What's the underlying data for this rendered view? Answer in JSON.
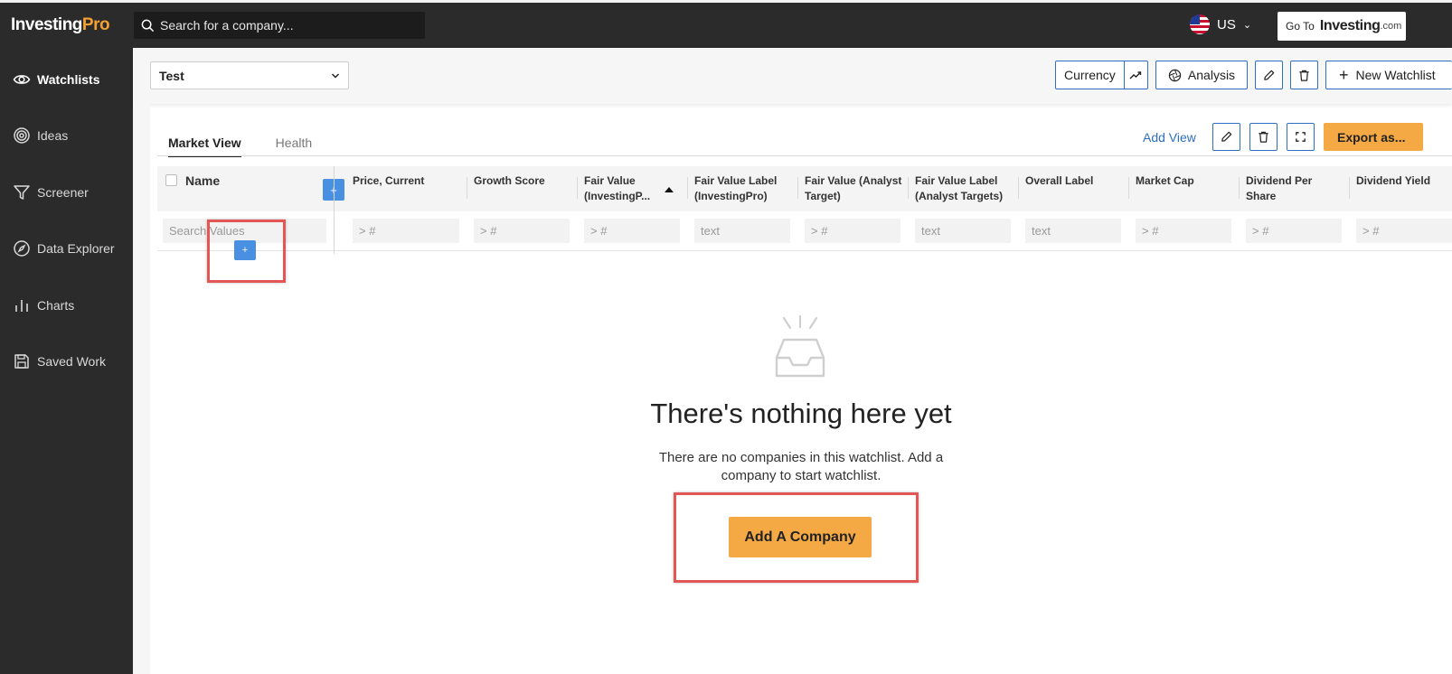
{
  "brand": {
    "name_main": "Investing",
    "name_pro": "Pro",
    "accent": "#f5a033"
  },
  "search": {
    "placeholder": "Search for a company..."
  },
  "region": {
    "label": "US"
  },
  "goto": {
    "prefix": "Go To",
    "site": "Investing",
    "suffix": ".com"
  },
  "sidebar": {
    "items": [
      {
        "label": "Watchlists",
        "icon": "eye-icon",
        "active": true
      },
      {
        "label": "Ideas",
        "icon": "target-icon"
      },
      {
        "label": "Screener",
        "icon": "filter-icon"
      },
      {
        "label": "Data Explorer",
        "icon": "compass-icon"
      },
      {
        "label": "Charts",
        "icon": "bar-chart-icon"
      },
      {
        "label": "Saved Work",
        "icon": "floppy-icon"
      }
    ]
  },
  "toolbar": {
    "watchlist_selected": "Test",
    "currency_label": "Currency",
    "analysis_label": "Analysis",
    "new_watchlist_label": "New Watchlist"
  },
  "panel": {
    "tabs": [
      {
        "label": "Market View",
        "active": true
      },
      {
        "label": "Health"
      }
    ],
    "add_view_label": "Add View",
    "export_label": "Export as..."
  },
  "table": {
    "name_header": "Name",
    "name_filter_placeholder": "Search Values",
    "columns": [
      {
        "header": "Price, Current",
        "filter": "> #"
      },
      {
        "header": "Growth Score",
        "filter": "> #"
      },
      {
        "header": "Fair Value (InvestingP...",
        "filter": "> #",
        "sorted": "asc"
      },
      {
        "header": "Fair Value Label (InvestingPro)",
        "filter": "text"
      },
      {
        "header": "Fair Value (Analyst Target)",
        "filter": "> #"
      },
      {
        "header": "Fair Value Label (Analyst Targets)",
        "filter": "text"
      },
      {
        "header": "Overall Label",
        "filter": "text"
      },
      {
        "header": "Market Cap",
        "filter": "> #"
      },
      {
        "header": "Dividend Per Share",
        "filter": "> #"
      },
      {
        "header": "Dividend Yield",
        "filter": "> #"
      }
    ]
  },
  "empty_state": {
    "title": "There's nothing here yet",
    "message": "There are no companies in this watchlist. Add a company to start watchlist.",
    "button": "Add A Company"
  }
}
